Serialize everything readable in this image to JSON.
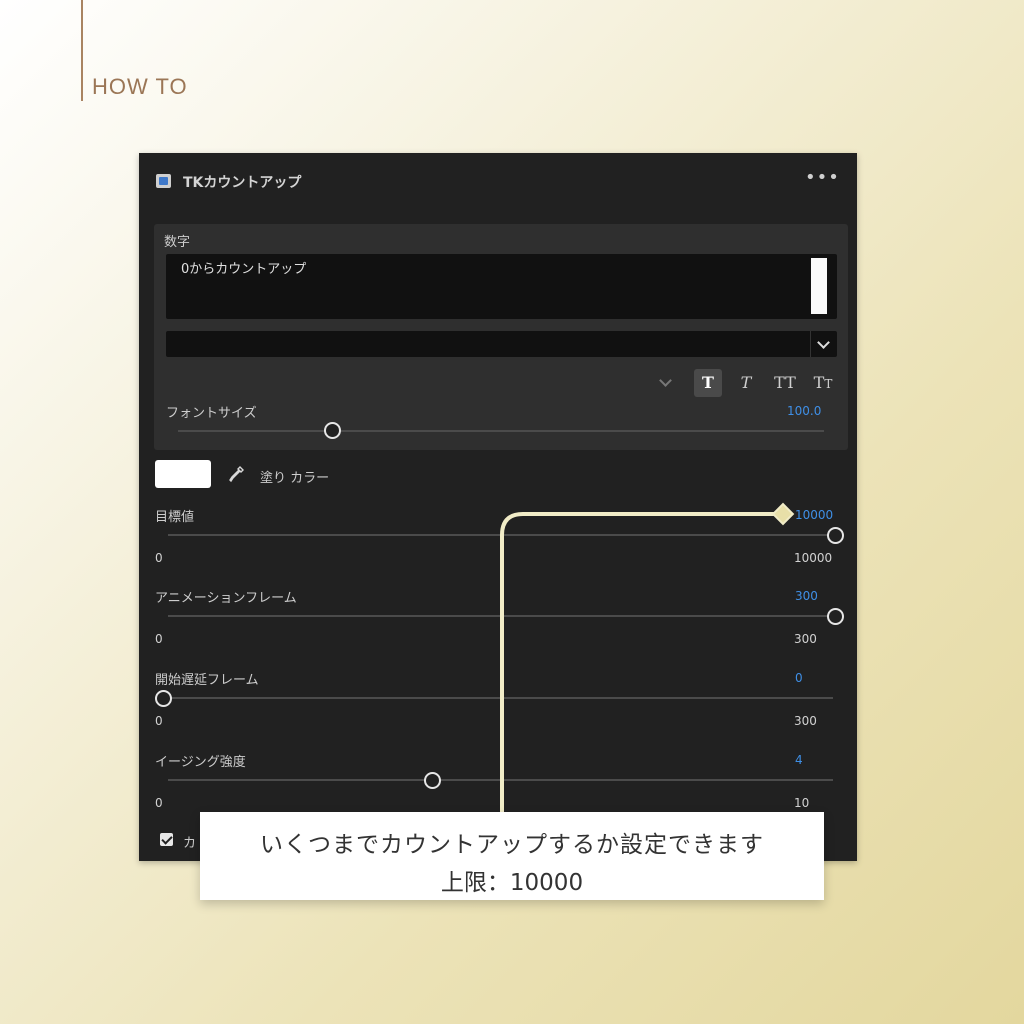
{
  "header": {
    "label": "HOW TO"
  },
  "panel": {
    "title": "TKカウントアップ",
    "more": "•••",
    "text_section": {
      "label": "数字",
      "text_value": "0からカウントアップ",
      "font_size_label": "フォントサイズ",
      "font_size_value": "100.0",
      "font_size_fraction": 0.25
    },
    "fill": {
      "color": "#ffffff",
      "label": "塗り カラー"
    },
    "sliders": [
      {
        "label": "目標値",
        "value": "10000",
        "min": "0",
        "max": "10000"
      },
      {
        "label": "アニメーションフレーム",
        "value": "300",
        "min": "0",
        "max": "300"
      },
      {
        "label": "開始遅延フレーム",
        "value": "0",
        "min": "0",
        "max": "300"
      },
      {
        "label": "イージング強度",
        "value": "4",
        "min": "0",
        "max": "10"
      }
    ],
    "checkbox_label": "カ"
  },
  "callout": {
    "line1": "いくつまでカウントアップするか設定できます",
    "line2": "上限：10000"
  },
  "colors": {
    "accent_value": "#3f8fe6",
    "connector": "#f1ecc7",
    "panel_bg": "#212121"
  }
}
